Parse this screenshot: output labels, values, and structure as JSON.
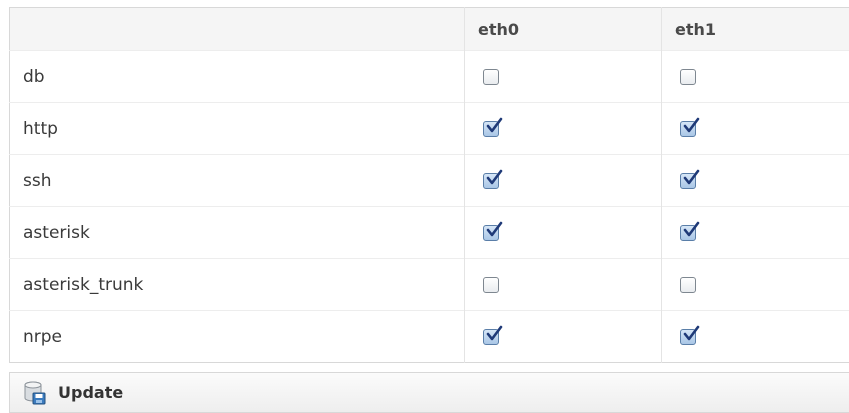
{
  "table": {
    "columns": [
      "",
      "eth0",
      "eth1"
    ],
    "rows": [
      {
        "service": "db",
        "eth0": false,
        "eth1": false
      },
      {
        "service": "http",
        "eth0": true,
        "eth1": true
      },
      {
        "service": "ssh",
        "eth0": true,
        "eth1": true
      },
      {
        "service": "asterisk",
        "eth0": true,
        "eth1": true
      },
      {
        "service": "asterisk_trunk",
        "eth0": false,
        "eth1": false
      },
      {
        "service": "nrpe",
        "eth0": true,
        "eth1": true
      }
    ]
  },
  "update_button": {
    "label": "Update",
    "icon": "database-save-icon"
  },
  "colors": {
    "checkbox_checked": "#a9c6e6",
    "checkmark": "#1f3a78"
  }
}
